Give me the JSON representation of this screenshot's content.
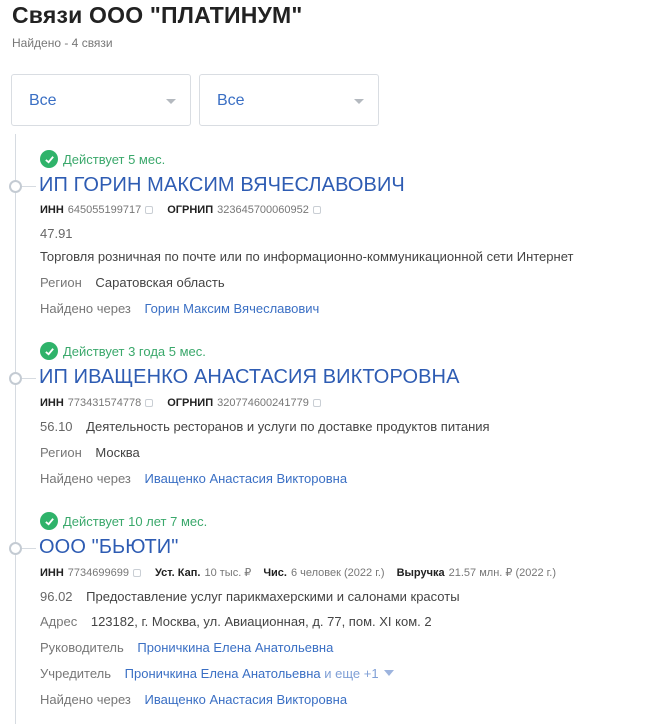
{
  "header": {
    "title": "Связи ООО \"ПЛАТИНУМ\"",
    "found": "Найдено - 4 связи"
  },
  "filters": [
    {
      "value": "Все"
    },
    {
      "value": "Все"
    }
  ],
  "entries": [
    {
      "status": "Действует 5 мес.",
      "name": "ИП ГОРИН МАКСИМ ВЯЧЕСЛАВОВИЧ",
      "inn_label": "ИНН",
      "inn": "645055199717",
      "ogrnip_label": "ОГРНИП",
      "ogrnip": "323645700060952",
      "okved_code": "47.91",
      "okved_text": "Торговля розничная по почте или по информационно-коммуникационной сети Интернет",
      "region_label": "Регион",
      "region": "Саратовская область",
      "found_via_label": "Найдено через",
      "found_via": "Горин Максим Вячеславович"
    },
    {
      "status": "Действует 3 года 5 мес.",
      "name": "ИП ИВАЩЕНКО АНАСТАСИЯ ВИКТОРОВНА",
      "inn_label": "ИНН",
      "inn": "773431574778",
      "ogrnip_label": "ОГРНИП",
      "ogrnip": "320774600241779",
      "okved_code": "56.10",
      "okved_text": "Деятельность ресторанов и услуги по доставке продуктов питания",
      "region_label": "Регион",
      "region": "Москва",
      "found_via_label": "Найдено через",
      "found_via": "Иващенко Анастасия Викторовна"
    },
    {
      "status": "Действует 10 лет 7 мес.",
      "name": "ООО \"БЬЮТИ\"",
      "inn_label": "ИНН",
      "inn": "7734699699",
      "capital_label": "Уст. Кап.",
      "capital": "10 тыс. ₽",
      "staff_label": "Чис.",
      "staff": "6 человек (2022 г.)",
      "revenue_label": "Выручка",
      "revenue": "21.57 млн. ₽ (2022 г.)",
      "okved_code": "96.02",
      "okved_text": "Предоставление услуг парикмахерскими и салонами красоты",
      "address_label": "Адрес",
      "address": "123182, г. Москва, ул. Авиационная, д. 77, пом. XI ком. 2",
      "director_label": "Руководитель",
      "director": "Проничкина Елена Анатольевна",
      "founder_label": "Учредитель",
      "founder": "Проничкина Елена Анатольевна",
      "founder_more": "и еще +1",
      "found_via_label": "Найдено через",
      "found_via": "Иващенко Анастасия Викторовна"
    }
  ],
  "icons": {
    "status": "check-circle-icon",
    "copy": "copy-icon",
    "dropdown": "chevron-down-icon",
    "expand": "caret-down-icon"
  },
  "colors": {
    "link": "#2e5cb3",
    "status_green": "#2fb36a"
  }
}
